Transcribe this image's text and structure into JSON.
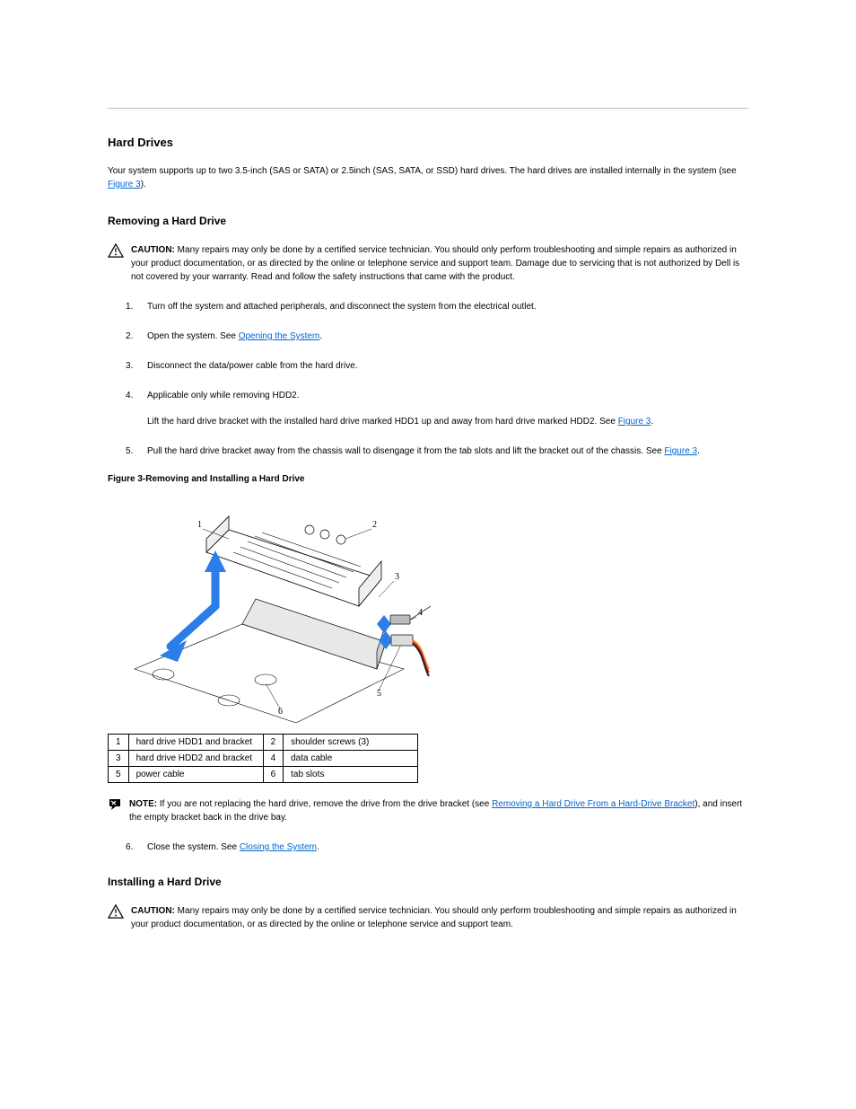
{
  "section_title": "Hard Drives",
  "intro_parts": {
    "before_first_omitted": "Your system supports up to two 3.5-inch (SAS or SATA) or 2.5",
    "after_first_omitted": "inch (SAS, SATA, or SSD) hard drives. The hard drives are installed internally in the system (see ",
    "link_text": "Figure 3",
    "tail": "",
    "trailing": ")."
  },
  "remove_heading": "Removing a Hard Drive",
  "caution_label": "CAUTION: ",
  "caution_body": "Many repairs may only be done by a certified service technician. You should only perform troubleshooting and simple repairs as authorized in your product documentation, or as directed by the online or telephone service and support team. Damage due to servicing that is not authorized by Dell is not covered by your warranty. Read and follow the safety instructions that came with the product.",
  "remove_steps": {
    "s1": "Turn off the system and attached peripherals, and disconnect the system from the electrical outlet.",
    "s2_before": "Open the system. See ",
    "s2_link": "Opening the System",
    "s2_after": ".",
    "s3": "Disconnect the data/power cable from the hard drive.",
    "s4_before": "Lift the hard drive bracket with the installed hard drive marked HDD1 up and away from hard drive marked HDD2. See ",
    "s4_link": "Figure 3",
    "s4_after": ".",
    "s5_before": "Pull the hard drive bracket away from the chassis wall to disengage it from the tab slots and lift the bracket out of the chassis. See ",
    "s5_link": "Figure 3",
    "s5_after": ".",
    "s5_note": "Applicable only while removing HDD2.",
    "s5_link2_intro": " See ",
    "note_label": "NOTE:",
    "note_body": " If you are not replacing the hard drive, remove the drive from the drive bracket (see ",
    "note_link": "Removing a Hard Drive From a Hard-Drive Bracket",
    "note_body_after": "), and insert the empty bracket back in the drive bay.",
    "s6_before": "Close the system. See ",
    "s6_link": "Closing the System",
    "s6_after": "."
  },
  "figure_caption_prefix": "Figure 3-",
  "figure_caption_body": "Removing and Installing a Hard Drive",
  "callouts": {
    "r1c1": "1",
    "r1c2": "hard drive HDD1 and bracket",
    "r1c3": "2",
    "r1c4": "shoulder screws (3)",
    "r2c1": "3",
    "r2c2": "hard drive HDD2 and bracket",
    "r2c3": "4",
    "r2c4": "data cable",
    "r3c1": "5",
    "r3c2": "power cable",
    "r3c3": "6",
    "r3c4": "tab slots"
  },
  "install_heading": "Installing a Hard Drive",
  "install_caution_body": "Many repairs may only be done by a certified service technician. You should only perform troubleshooting and simple repairs as authorized in your product documentation, or as directed by the online or telephone service and support team."
}
